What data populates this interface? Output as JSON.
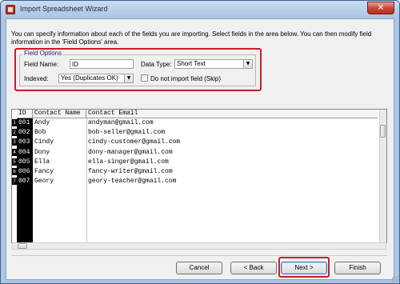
{
  "window": {
    "title": "Import Spreadsheet Wizard",
    "close_label": "×"
  },
  "intro": {
    "text": "You can specify information about each of the fields you are importing. Select fields in the area below. You can then modify field information in the 'Field Options' area."
  },
  "field_options": {
    "legend": "Field Options",
    "field_name_label": "Field Name:",
    "field_name_value": "ID",
    "data_type_label": "Data Type:",
    "data_type_value": "Short Text",
    "indexed_label": "Indexed:",
    "indexed_value": "Yes (Duplicates OK)",
    "skip_label": "Do not import field (Skip)",
    "skip_checked": false
  },
  "grid": {
    "columns": [
      "ID",
      "Contact Name",
      "Contact Email"
    ],
    "rows": [
      {
        "num": "1",
        "id": "001",
        "name": "Andy",
        "email": "andyman@gmail.com"
      },
      {
        "num": "2",
        "id": "002",
        "name": "Bob",
        "email": "bob-seller@gmail.com"
      },
      {
        "num": "3",
        "id": "003",
        "name": "Cindy",
        "email": "cindy-customer@gmail.com"
      },
      {
        "num": "4",
        "id": "004",
        "name": "Dony",
        "email": "dony-manager@gmail.com"
      },
      {
        "num": "5",
        "id": "005",
        "name": "Ella",
        "email": "ella-singer@gmail.com"
      },
      {
        "num": "6",
        "id": "006",
        "name": "Fancy",
        "email": "fancy-writer@gmail.com"
      },
      {
        "num": "7",
        "id": "007",
        "name": "Geory",
        "email": "geory-teacher@gmail.com"
      }
    ]
  },
  "buttons": {
    "cancel": "Cancel",
    "back": "< Back",
    "next": "Next >",
    "finish": "Finish"
  },
  "colors": {
    "highlight": "#c0202a",
    "selected_column": "#000000"
  }
}
